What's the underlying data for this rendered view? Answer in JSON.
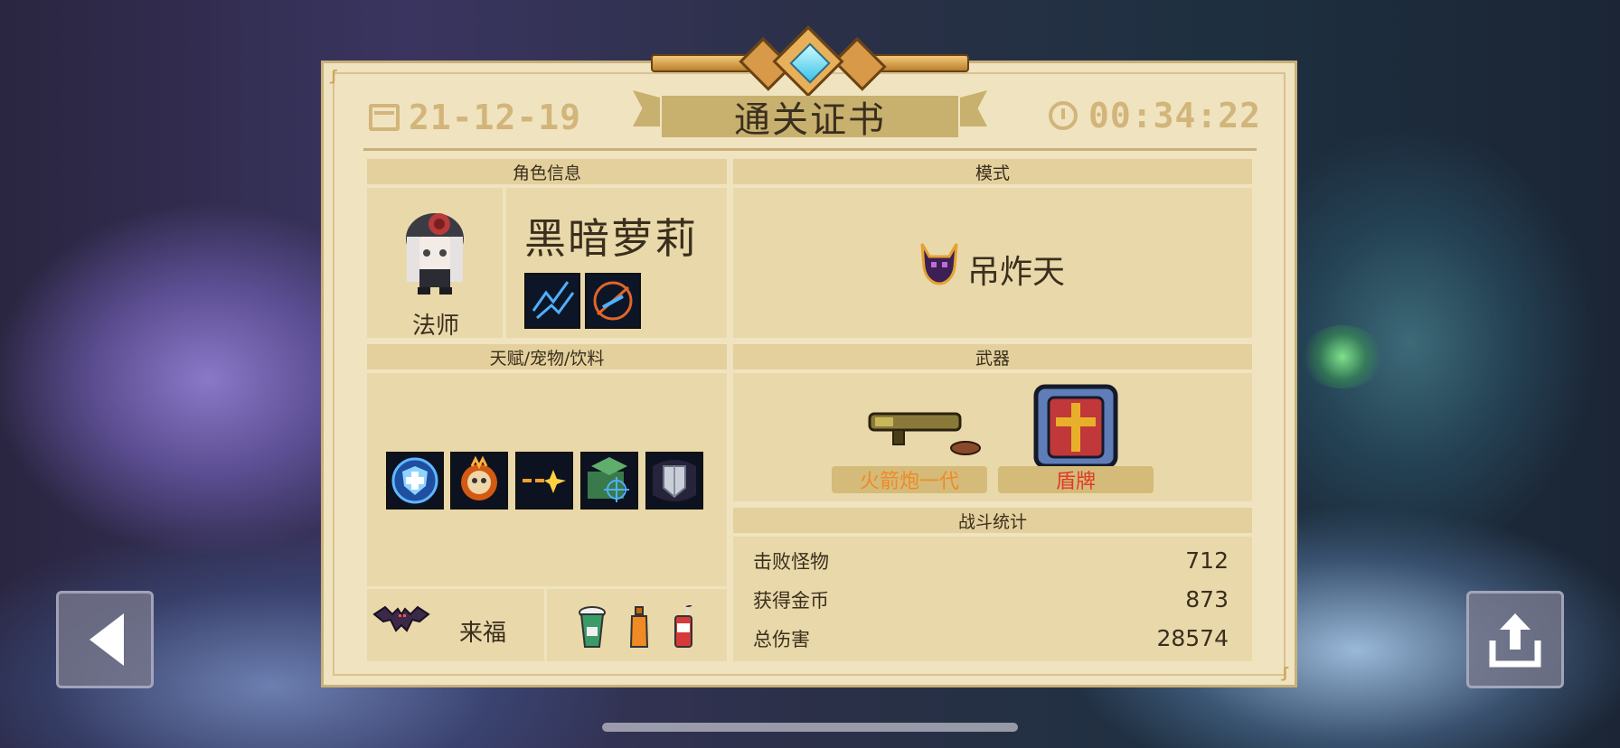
{
  "header": {
    "date": "21-12-19",
    "title": "通关证书",
    "time": "00:34:22"
  },
  "role": {
    "section_title": "角色信息",
    "name": "黑暗萝莉",
    "class_label": "法师",
    "skill_icons": [
      "lightning-skill-icon",
      "arrow-slash-skill-icon"
    ]
  },
  "mode": {
    "section_title": "模式",
    "name": "吊炸天",
    "icon": "demon-helmet-icon"
  },
  "talents": {
    "section_title": "天赋/宠物/饮料",
    "icons": [
      "shield-plus-talent-icon",
      "flaming-skull-talent-icon",
      "bullet-spark-talent-icon",
      "crosshair-map-talent-icon",
      "armor-plate-talent-icon"
    ],
    "pet_name": "来福",
    "pet_icon": "bat-pet-icon",
    "drinks": [
      "green-cup-drink-icon",
      "orange-bottle-drink-icon",
      "red-can-drink-icon"
    ]
  },
  "weapons": {
    "section_title": "武器",
    "items": [
      {
        "name": "火箭炮一代",
        "color": "#f08a24",
        "icon": "rocket-launcher-icon"
      },
      {
        "name": "盾牌",
        "color": "#e03a2a",
        "icon": "shield-weapon-icon"
      }
    ]
  },
  "stats": {
    "section_title": "战斗统计",
    "rows": [
      {
        "label": "击败怪物",
        "value": "712"
      },
      {
        "label": "获得金币",
        "value": "873"
      },
      {
        "label": "总伤害",
        "value": "28574"
      }
    ]
  },
  "nav": {
    "back_icon": "back-arrow-icon",
    "share_icon": "share-icon"
  },
  "colors": {
    "card_bg": "#f0e3c0",
    "panel_bg": "#e9d8a9",
    "header_bg": "#e3d09d",
    "gold_text": "#d2b57a"
  }
}
